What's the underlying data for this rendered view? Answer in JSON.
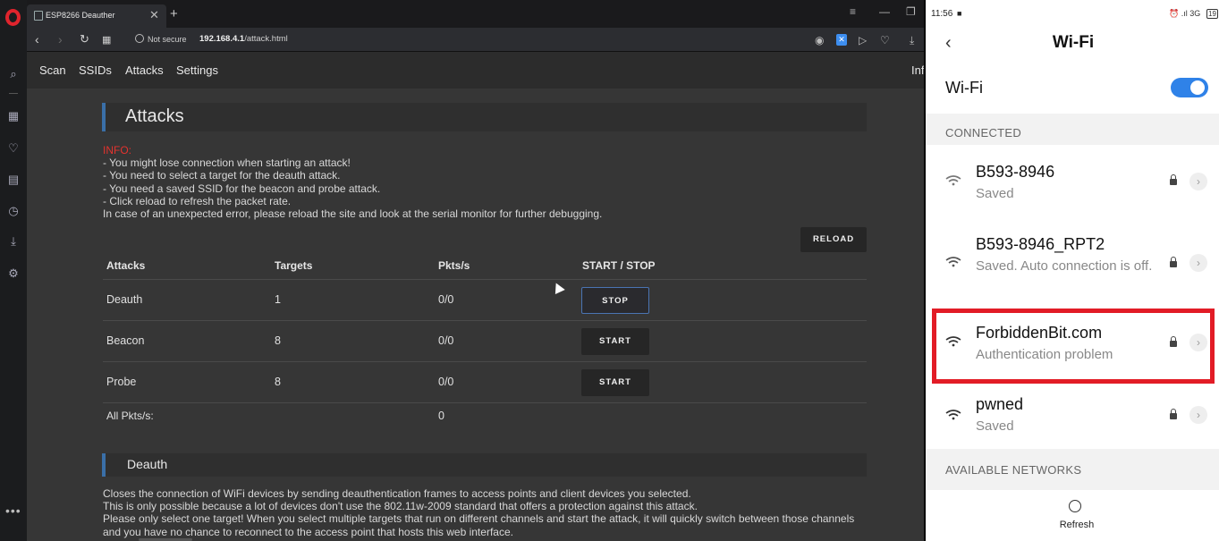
{
  "browser": {
    "tab_title": "ESP8266 Deauther",
    "security_label": "Not secure",
    "url_host": "192.168.4.1",
    "url_path": "/attack.html"
  },
  "nav": {
    "items": [
      "Scan",
      "SSIDs",
      "Attacks",
      "Settings"
    ],
    "info": "Info"
  },
  "attacks_section": {
    "title": "Attacks",
    "info_label": "INFO:",
    "info_lines": [
      "- You might lose connection when starting an attack!",
      "- You need to select a target for the deauth attack.",
      "- You need a saved SSID for the beacon and probe attack.",
      "- Click reload to refresh the packet rate.",
      "In case of an unexpected error, please reload the site and look at the serial monitor for further debugging."
    ],
    "reload_label": "RELOAD",
    "table": {
      "headers": [
        "Attacks",
        "Targets",
        "Pkts/s",
        "START / STOP"
      ],
      "rows": [
        {
          "name": "Deauth",
          "targets": "1",
          "pkts": "0/0",
          "action": "STOP"
        },
        {
          "name": "Beacon",
          "targets": "8",
          "pkts": "0/0",
          "action": "START"
        },
        {
          "name": "Probe",
          "targets": "8",
          "pkts": "0/0",
          "action": "START"
        }
      ],
      "total_label": "All Pkts/s:",
      "total_value": "0"
    }
  },
  "deauth_section": {
    "title": "Deauth",
    "lines": [
      "Closes the connection of WiFi devices by sending deauthentication frames to access points and client devices you selected.",
      "This is only possible because a lot of devices don't use the 802.11w-2009 standard that offers a protection against this attack.",
      "Please only select one target! When you select multiple targets that run on different channels and start the attack, it will quickly switch between those channels and you have no chance to reconnect to the access point that hosts this web interface."
    ]
  },
  "phone": {
    "time": "11:56",
    "status_right": "⏰ .ıl 3G",
    "battery": "19",
    "title": "Wi-Fi",
    "wifi_label": "Wi-Fi",
    "wifi_enabled": true,
    "connected_label": "CONNECTED",
    "networks": [
      {
        "name": "B593-8946",
        "status": "Saved"
      },
      {
        "name": "B593-8946_RPT2",
        "status": "Saved. Auto connection is off."
      },
      {
        "name": "ForbiddenBit.com",
        "status": "Authentication problem"
      },
      {
        "name": "pwned",
        "status": "Saved"
      }
    ],
    "available_label": "AVAILABLE NETWORKS",
    "refresh_label": "Refresh"
  },
  "colors": {
    "accent_blue": "#3a6fa8",
    "info_red": "#e4322e",
    "highlight_red": "#e21c26",
    "toggle_blue": "#2f82e8"
  }
}
